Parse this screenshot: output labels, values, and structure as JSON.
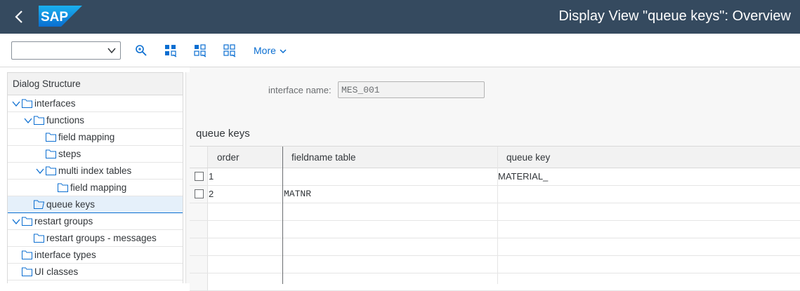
{
  "shell": {
    "logo_text": "SAP",
    "title": "Display View \"queue keys\": Overview"
  },
  "toolbar": {
    "combo_value": "",
    "more_label": "More"
  },
  "tree": {
    "header": "Dialog Structure",
    "items": [
      {
        "label": "interfaces"
      },
      {
        "label": "functions"
      },
      {
        "label": "field mapping"
      },
      {
        "label": "steps"
      },
      {
        "label": "multi index tables"
      },
      {
        "label": "field mapping"
      },
      {
        "label": "queue keys"
      },
      {
        "label": "restart groups"
      },
      {
        "label": "restart groups - messages"
      },
      {
        "label": "interface types"
      },
      {
        "label": "UI classes"
      }
    ]
  },
  "form": {
    "interface_label": "interface name:",
    "interface_value": "MES_001"
  },
  "table": {
    "title": "queue keys",
    "columns": [
      "order",
      "fieldname table",
      "queue key"
    ],
    "rows": [
      {
        "order": "1",
        "fieldname": "",
        "queue_key": "MATERIAL_"
      },
      {
        "order": "2",
        "fieldname": "MATNR",
        "queue_key": ""
      }
    ]
  },
  "colors": {
    "shell_bg": "#354a5f",
    "link_blue": "#0a6ed1",
    "selection_bg": "#e5f0fa"
  }
}
